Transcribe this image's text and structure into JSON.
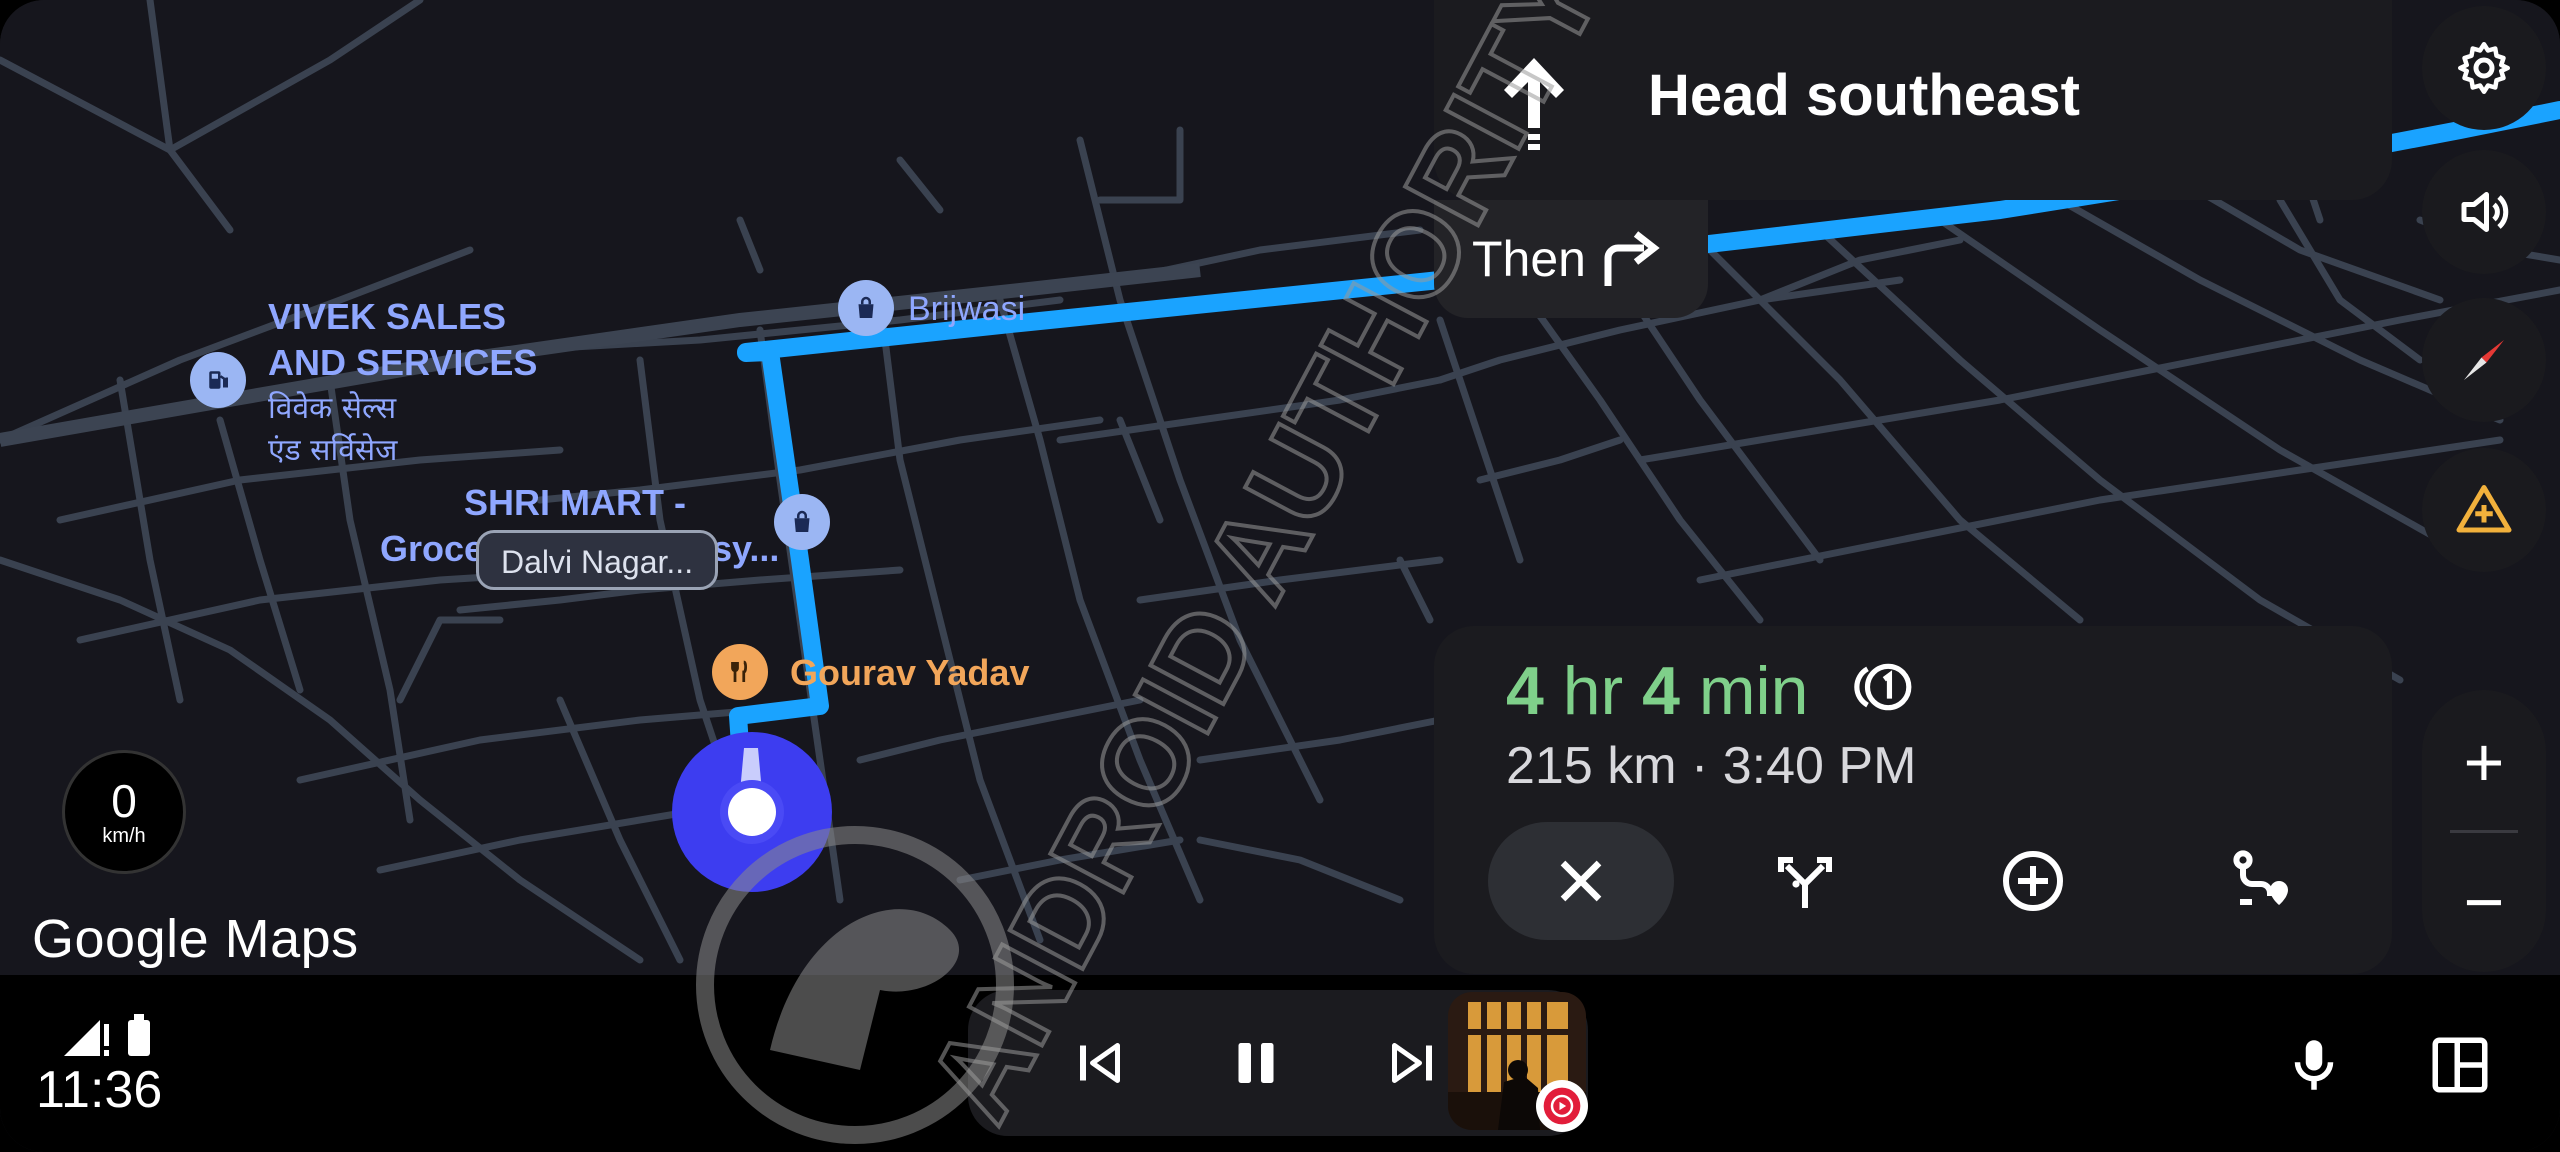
{
  "navigation": {
    "instruction": "Head southeast",
    "then_label": "Then",
    "then_icon": "turn-right-icon",
    "direction_icon": "straight-arrow-icon"
  },
  "eta": {
    "duration_hours": "4",
    "duration_hr_unit": "hr",
    "duration_minutes": "4",
    "duration_min_unit": "min",
    "distance": "215 km",
    "separator": "·",
    "arrival_time": "3:40 PM",
    "actions": [
      "close-icon",
      "alternate-routes-icon",
      "add-stop-icon",
      "route-overview-icon"
    ]
  },
  "map": {
    "poi": {
      "vivek_en": [
        "VIVEK SALES",
        "AND SERVICES"
      ],
      "vivek_hi": [
        "विवेक सेल्स",
        "एंड सर्विसेज"
      ],
      "brijwasi": "Brijwasi",
      "shri_mart": "SHRI MART -",
      "shri_mart_2": "Groce",
      "shri_mart_3": "sy...",
      "street_chip": "Dalvi Nagar...",
      "gourav": "Gourav Yadav"
    },
    "route_color": "#1aa3ff",
    "location_color": "#3d3df0"
  },
  "speed": {
    "value": "0",
    "unit": "km/h"
  },
  "brand": {
    "logo_text": "Google Maps"
  },
  "side_buttons": [
    "settings-icon",
    "volume-icon",
    "compass-icon",
    "report-incident-icon"
  ],
  "zoom": {
    "in": "+",
    "out": "−"
  },
  "status": {
    "time": "11:36",
    "icons": [
      "signal-icon",
      "battery-icon"
    ]
  },
  "media": {
    "controls": [
      "previous-icon",
      "pause-icon",
      "next-icon"
    ],
    "app_badge": "youtube-music-icon"
  },
  "watermark": {
    "text": "ANDROID AUTHORITY"
  },
  "colors": {
    "eta_green": "#7fd08a",
    "card_bg": "#1b1b1f",
    "map_bg": "#16161d",
    "road": "#3c4452"
  }
}
